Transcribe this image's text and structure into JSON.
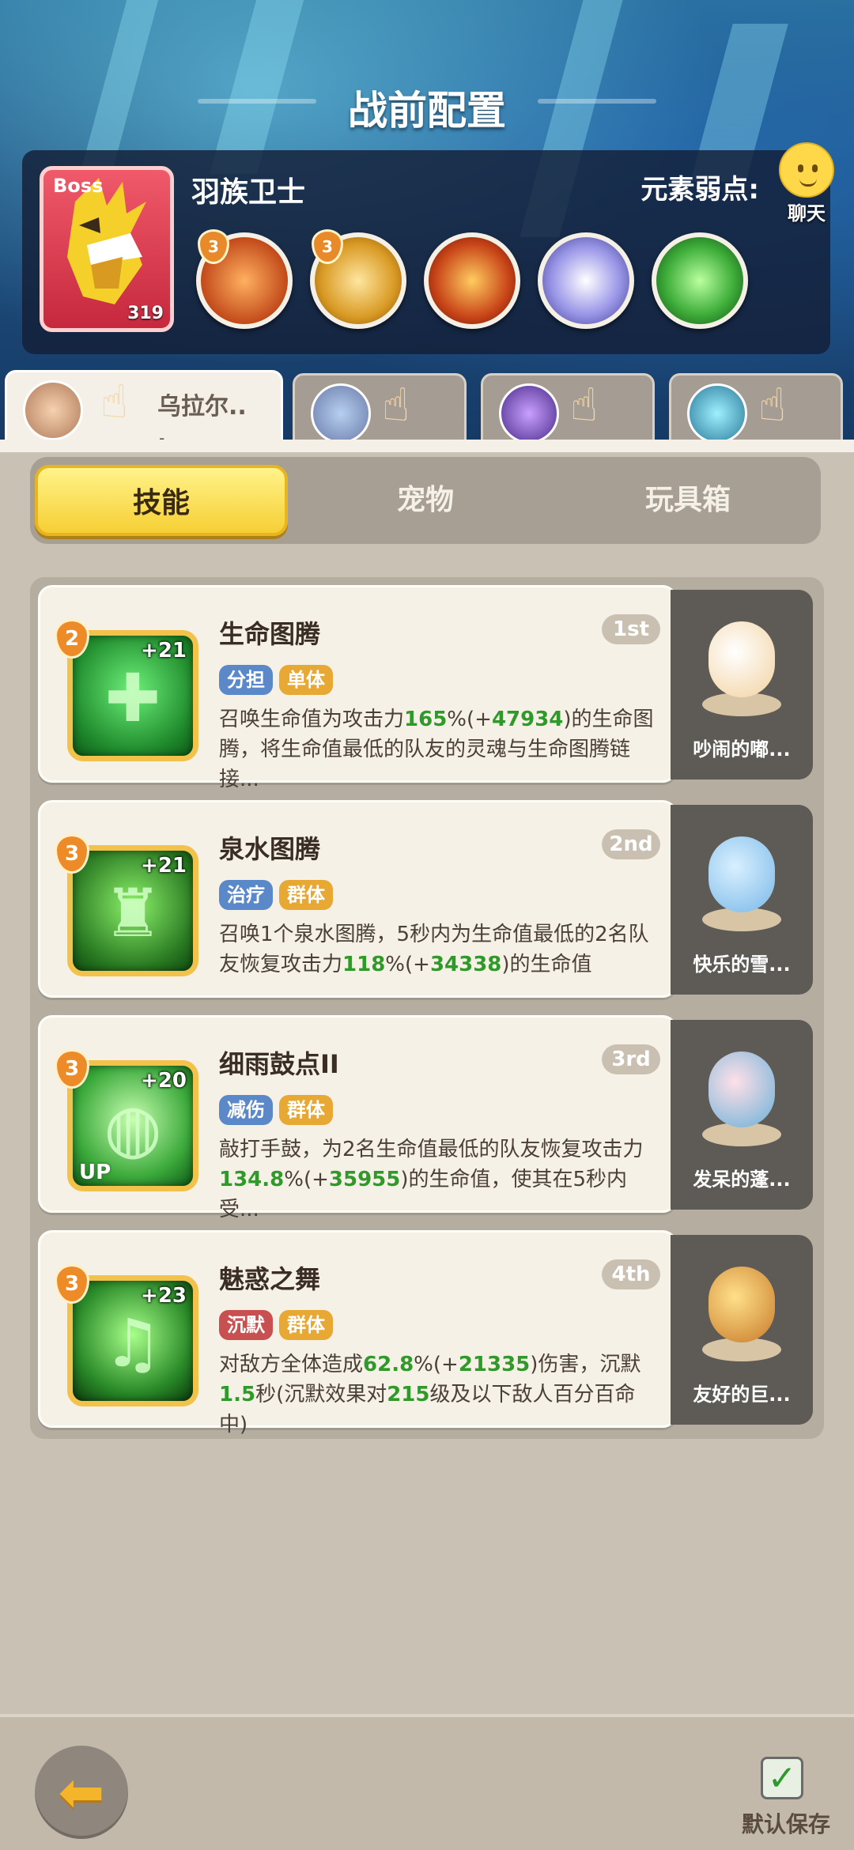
{
  "screen_title": "战前配置",
  "boss": {
    "tag": "Boss",
    "name": "羽族卫士",
    "level": "319"
  },
  "element_weakness_label": "元素弱点:",
  "boss_skills": [
    {
      "badge": "3",
      "icon": "fire-claw-icon",
      "color": "#d9642a"
    },
    {
      "badge": "3",
      "icon": "gold-shield-icon",
      "color": "#e3a22f"
    },
    {
      "badge": "",
      "icon": "flame-slash-icon",
      "color": "#c9471e"
    },
    {
      "badge": "",
      "icon": "wind-swirl-icon",
      "color": "#8a86d6"
    },
    {
      "badge": "",
      "icon": "poison-slime-icon",
      "color": "#3fae3a"
    }
  ],
  "chat": {
    "label": "聊天"
  },
  "heroes": [
    {
      "name": "乌拉尔..\n.",
      "active": true
    },
    {
      "name": "",
      "active": false
    },
    {
      "name": "",
      "active": false
    },
    {
      "name": "",
      "active": false
    }
  ],
  "tabs": {
    "skills": "技能",
    "pets": "宠物",
    "toybox": "玩具箱"
  },
  "skills": [
    {
      "level": "2",
      "plus": "+21",
      "name": "生命图腾",
      "rank": "1st",
      "tag1": "分担",
      "tag2": "单体",
      "tag1_color": "blue",
      "desc_a": "召唤生命值为攻击力",
      "pct": "165",
      "desc_b": "%(+",
      "bonus": "47934",
      "desc_c": ")的生命图腾，将生命值最低的队友的灵魂与生命图腾链接...",
      "pet_name": "吵闹的嘟..."
    },
    {
      "level": "3",
      "plus": "+21",
      "name": "泉水图腾",
      "rank": "2nd",
      "tag1": "治疗",
      "tag2": "群体",
      "tag1_color": "blue",
      "desc_a": "召唤1个泉水图腾，5秒内为生命值最低的2名队友恢复攻击力",
      "pct": "118",
      "desc_b": "%(+",
      "bonus": "34338",
      "desc_c": ")的生命值",
      "pet_name": "快乐的雪..."
    },
    {
      "level": "3",
      "plus": "+20",
      "up": "UP",
      "name": "细雨鼓点II",
      "rank": "3rd",
      "tag1": "减伤",
      "tag2": "群体",
      "tag1_color": "blue",
      "desc_a": "敲打手鼓，为2名生命值最低的队友恢复攻击力",
      "pct": "134.8",
      "desc_b": "%(+",
      "bonus": "35955",
      "desc_c": ")的生命值，使其在5秒内受...",
      "pet_name": "发呆的蓬..."
    },
    {
      "level": "3",
      "plus": "+23",
      "name": "魅惑之舞",
      "rank": "4th",
      "tag1": "沉默",
      "tag2": "群体",
      "tag1_color": "red",
      "desc_a": "对敌方全体造成",
      "pct": "62.8",
      "desc_b": "%(+",
      "bonus": "21335",
      "desc_c": ")伤害，沉默",
      "desc_d": "1.5",
      "desc_e": "秒(沉默效果对",
      "desc_f": "215",
      "desc_g": "级及以下敌人百分百命中)",
      "pet_name": "友好的巨..."
    }
  ],
  "bottom": {
    "save_label": "默认保存",
    "save_checked": true
  }
}
